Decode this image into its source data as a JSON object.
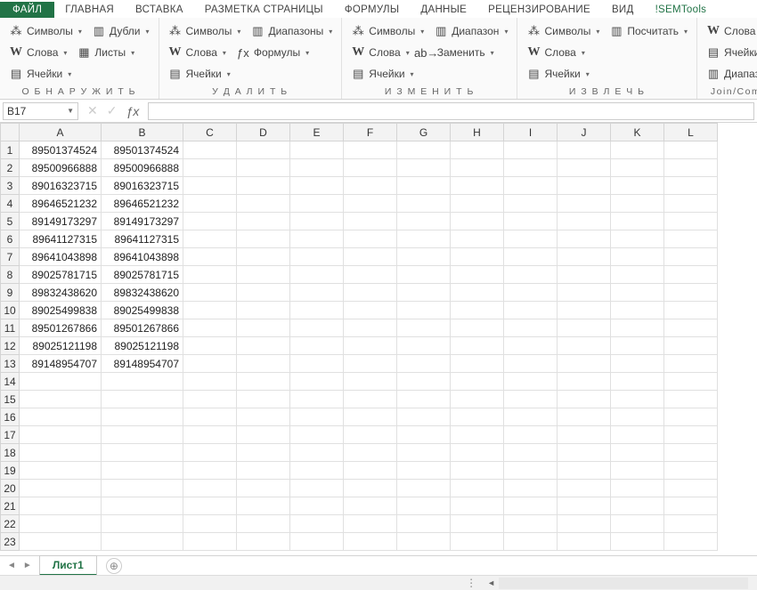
{
  "tabs": {
    "file": "ФАЙЛ",
    "items": [
      "ГЛАВНАЯ",
      "ВСТАВКА",
      "РАЗМЕТКА СТРАНИЦЫ",
      "ФОРМУЛЫ",
      "ДАННЫЕ",
      "РЕЦЕНЗИРОВАНИЕ",
      "ВИД",
      "!SEMTools"
    ],
    "active": "!SEMTools"
  },
  "ribbon": {
    "groups": [
      {
        "label": "О Б Н А Р У Ж И Т Ь",
        "rows": [
          [
            {
              "icon": "⁂",
              "text": "Символы"
            },
            {
              "icon": "▥",
              "text": "Дубли"
            }
          ],
          [
            {
              "icon": "W",
              "bold": true,
              "text": "Слова"
            },
            {
              "icon": "▦",
              "text": "Листы"
            }
          ],
          [
            {
              "icon": "▤",
              "text": "Ячейки"
            }
          ]
        ]
      },
      {
        "label": "У Д А Л И Т Ь",
        "rows": [
          [
            {
              "icon": "⁂",
              "text": "Символы"
            },
            {
              "icon": "▥",
              "text": "Диапазоны"
            }
          ],
          [
            {
              "icon": "W",
              "bold": true,
              "text": "Слова"
            },
            {
              "icon": "ƒx",
              "text": "Формулы"
            }
          ],
          [
            {
              "icon": "▤",
              "text": "Ячейки"
            }
          ]
        ]
      },
      {
        "label": "И З М Е Н И Т Ь",
        "rows": [
          [
            {
              "icon": "⁂",
              "text": "Символы"
            },
            {
              "icon": "▥",
              "text": "Диапазон"
            }
          ],
          [
            {
              "icon": "W",
              "bold": true,
              "text": "Слова"
            },
            {
              "icon": "ab→",
              "text": "Заменить"
            }
          ],
          [
            {
              "icon": "▤",
              "text": "Ячейки"
            }
          ]
        ]
      },
      {
        "label": "И З В Л Е Ч Ь",
        "rows": [
          [
            {
              "icon": "⁂",
              "text": "Символы"
            },
            {
              "icon": "▥",
              "text": "Посчитать"
            }
          ],
          [
            {
              "icon": "W",
              "bold": true,
              "text": "Слова"
            }
          ],
          [
            {
              "icon": "▤",
              "text": "Ячейки"
            }
          ]
        ]
      },
      {
        "label": "Join/Combine",
        "rows": [
          [
            {
              "icon": "W",
              "bold": true,
              "text": "Слова"
            }
          ],
          [
            {
              "icon": "▤",
              "text": "Ячейки"
            }
          ],
          [
            {
              "icon": "▥",
              "text": "Диапазоны"
            }
          ]
        ]
      }
    ]
  },
  "formula_bar": {
    "name_box": "B17",
    "formula": ""
  },
  "grid": {
    "columns": [
      "A",
      "B",
      "C",
      "D",
      "E",
      "F",
      "G",
      "H",
      "I",
      "J",
      "K",
      "L"
    ],
    "page_break_after_col": "H",
    "rows_visible": 23,
    "data": [
      [
        "89501374524",
        "89501374524"
      ],
      [
        "89500966888",
        "89500966888"
      ],
      [
        "89016323715",
        "89016323715"
      ],
      [
        "89646521232",
        "89646521232"
      ],
      [
        "89149173297",
        "89149173297"
      ],
      [
        "89641127315",
        "89641127315"
      ],
      [
        "89641043898",
        "89641043898"
      ],
      [
        "89025781715",
        "89025781715"
      ],
      [
        "89832438620",
        "89832438620"
      ],
      [
        "89025499838",
        "89025499838"
      ],
      [
        "89501267866",
        "89501267866"
      ],
      [
        "89025121198",
        "89025121198"
      ],
      [
        "89148954707",
        "89148954707"
      ]
    ]
  },
  "sheet_tabs": {
    "active": "Лист1"
  }
}
